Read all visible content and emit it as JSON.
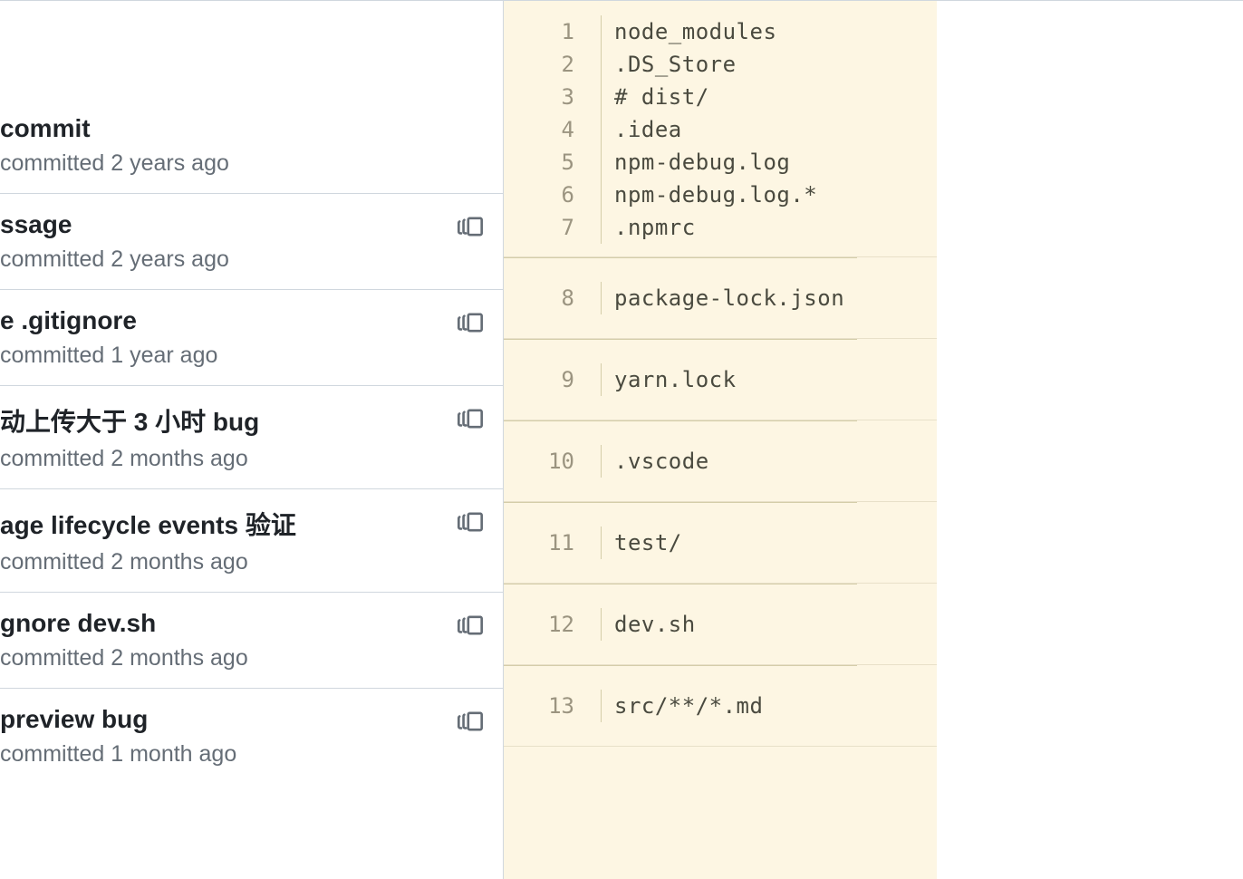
{
  "commits": [
    {
      "title": "commit",
      "meta": " committed 2 years ago",
      "hasCopy": false
    },
    {
      "title": "ssage",
      "meta": " committed 2 years ago",
      "hasCopy": true
    },
    {
      "title": "e .gitignore",
      "meta": " committed 1 year ago",
      "hasCopy": true
    },
    {
      "title": "动上传大于 3 小时 bug",
      "meta": " committed 2 months ago",
      "hasCopy": true
    },
    {
      "title": "age lifecycle events 验证",
      "meta": " committed 2 months ago",
      "hasCopy": true
    },
    {
      "title": "gnore dev.sh",
      "meta": " committed 2 months ago",
      "hasCopy": true
    },
    {
      "title": "preview bug",
      "meta": " committed 1 month ago",
      "hasCopy": true
    }
  ],
  "code_sections": [
    {
      "lines": [
        {
          "num": "1",
          "text": "node_modules"
        },
        {
          "num": "2",
          "text": ".DS_Store"
        },
        {
          "num": "3",
          "text": "# dist/"
        },
        {
          "num": "4",
          "text": ".idea"
        },
        {
          "num": "5",
          "text": "npm-debug.log"
        },
        {
          "num": "6",
          "text": "npm-debug.log.*"
        },
        {
          "num": "7",
          "text": ".npmrc"
        }
      ]
    },
    {
      "lines": [
        {
          "num": "8",
          "text": "package-lock.json"
        }
      ]
    },
    {
      "lines": [
        {
          "num": "9",
          "text": "yarn.lock"
        }
      ]
    },
    {
      "lines": [
        {
          "num": "10",
          "text": ".vscode"
        }
      ]
    },
    {
      "lines": [
        {
          "num": "11",
          "text": "test/"
        }
      ]
    },
    {
      "lines": [
        {
          "num": "12",
          "text": "dev.sh"
        }
      ]
    },
    {
      "lines": [
        {
          "num": "13",
          "text": "src/**/*.md"
        }
      ]
    }
  ]
}
